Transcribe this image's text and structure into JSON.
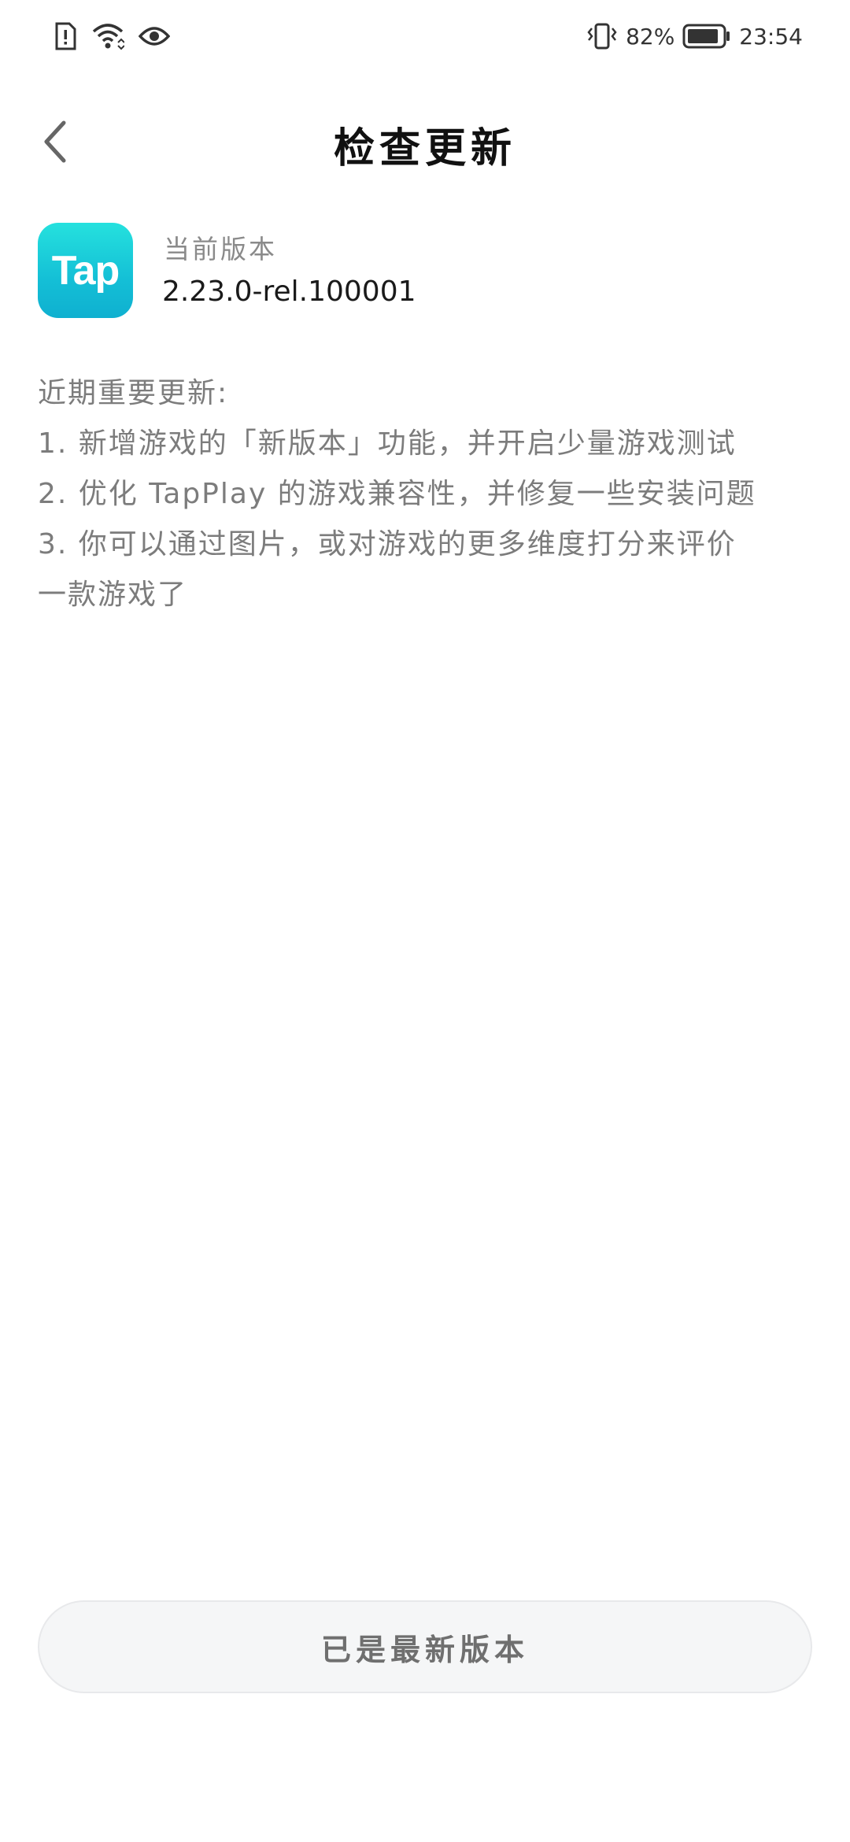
{
  "status_bar": {
    "icons_left": [
      "sim-alert-icon",
      "wifi-icon",
      "eye-icon"
    ],
    "battery_percent": "82%",
    "time": "23:54",
    "vibrate_icon": "vibrate-icon",
    "battery_icon": "battery-icon"
  },
  "header": {
    "title": "检查更新",
    "back_icon": "chevron-left-icon"
  },
  "version": {
    "app_icon_text": "Tap",
    "label": "当前版本",
    "value": "2.23.0-rel.100001"
  },
  "notes": {
    "heading": "近期重要更新:",
    "lines": [
      "1. 新增游戏的「新版本」功能，并开启少量游戏测试",
      "2. 优化 TapPlay 的游戏兼容性，并修复一些安装问题",
      "3. 你可以通过图片，或对游戏的更多维度打分来评价",
      "一款游戏了"
    ]
  },
  "button": {
    "label": "已是最新版本"
  },
  "colors": {
    "accent_gradient_top": "#25e1de",
    "accent_gradient_bottom": "#0fb0d0",
    "button_bg": "#f5f6f7"
  }
}
